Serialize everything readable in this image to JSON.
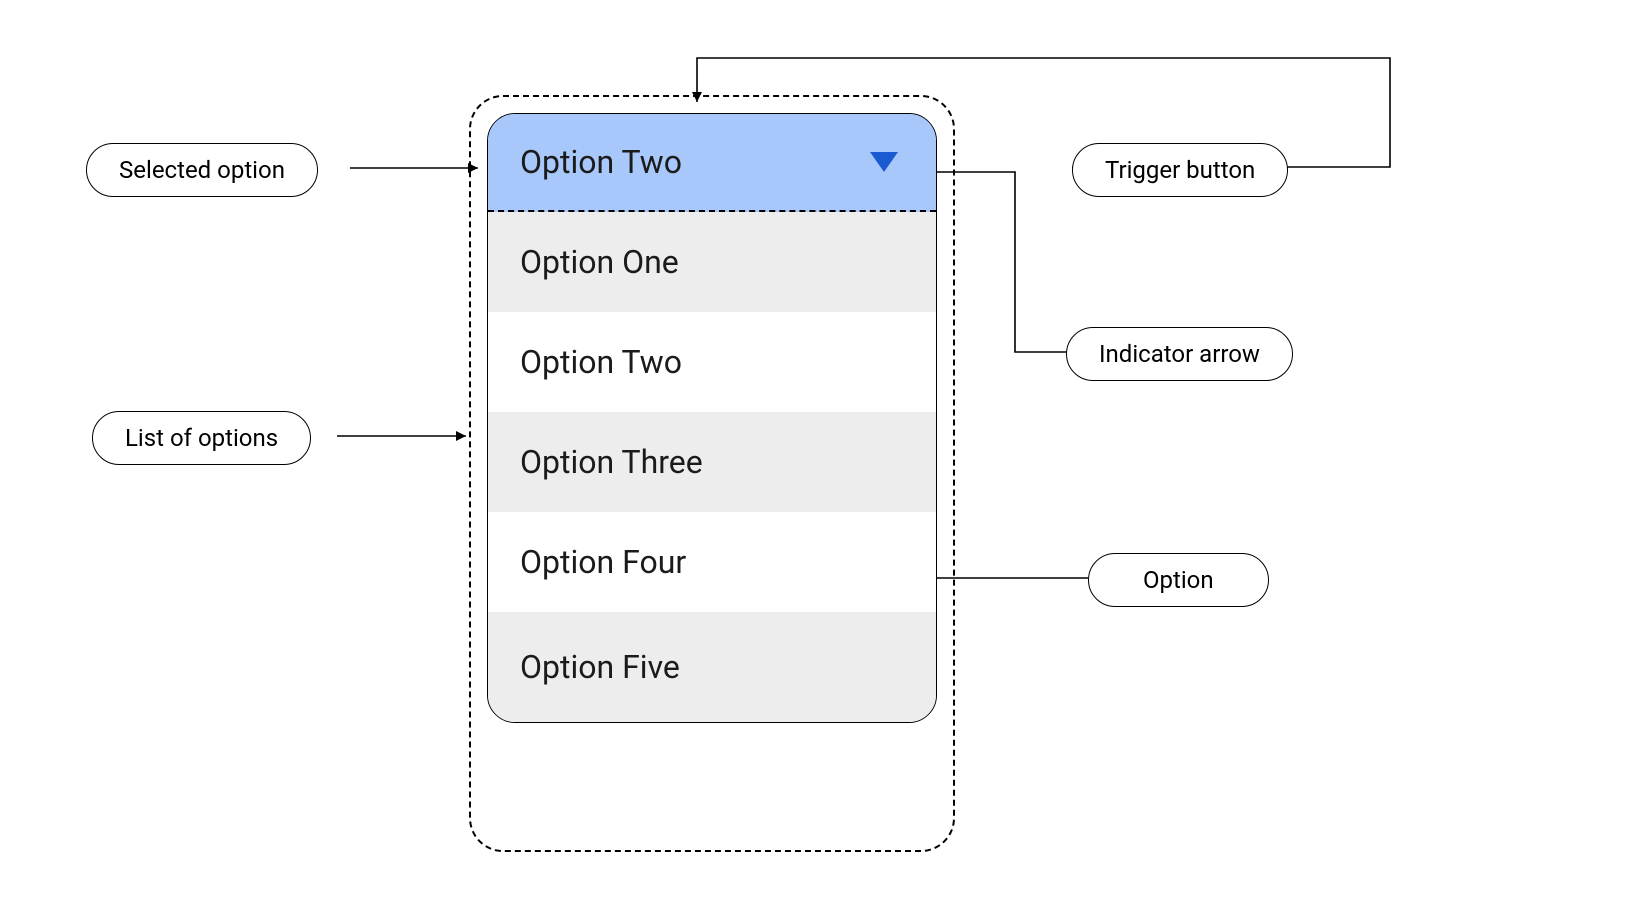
{
  "annotations": {
    "selected_option": "Selected option",
    "list_of_options": "List of options",
    "trigger_button": "Trigger button",
    "indicator_arrow": "Indicator arrow",
    "option": "Option"
  },
  "dropdown": {
    "selected": "Option Two",
    "options": [
      "Option One",
      "Option Two",
      "Option Three",
      "Option  Four",
      "Option Five"
    ]
  }
}
